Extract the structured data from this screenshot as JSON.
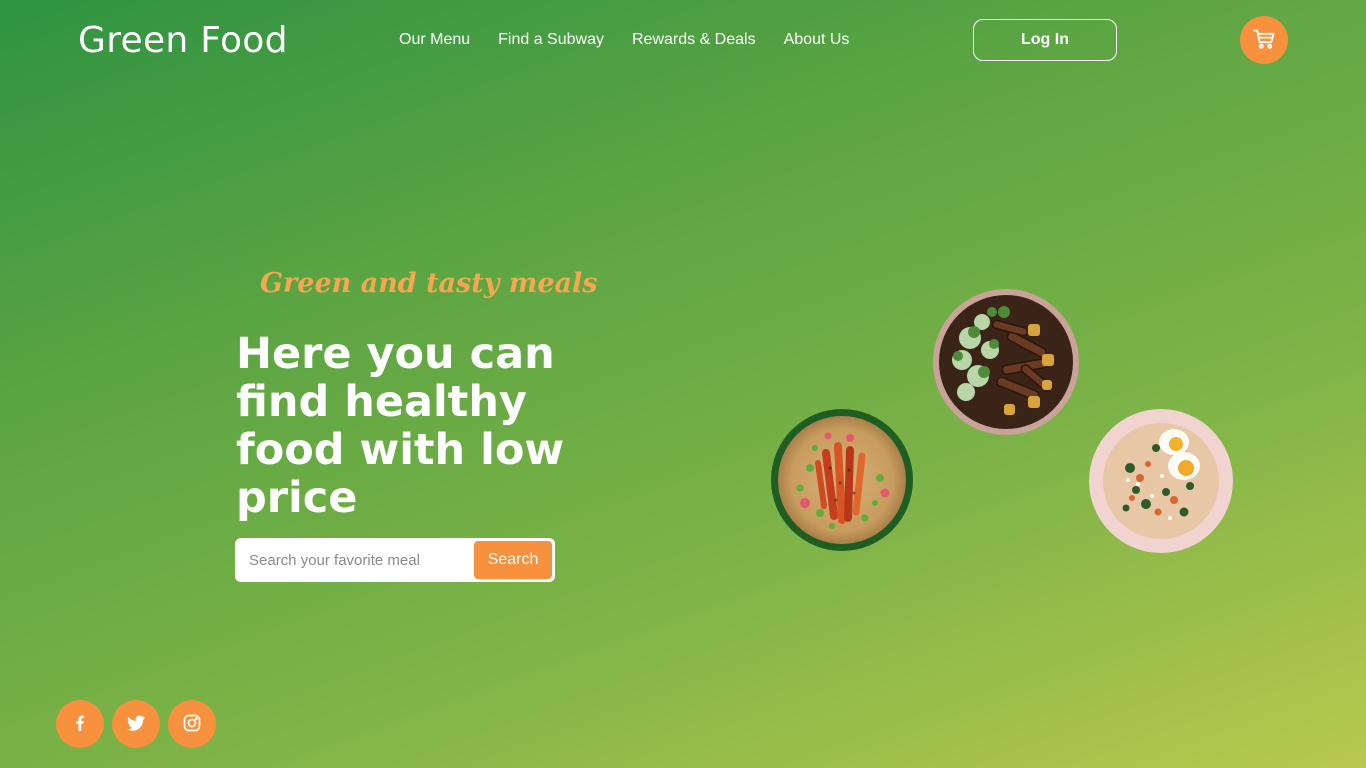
{
  "brand": {
    "logo_text": "Green Food"
  },
  "nav": {
    "items": [
      {
        "label": "Our Menu"
      },
      {
        "label": "Find a Subway"
      },
      {
        "label": "Rewards & Deals"
      },
      {
        "label": "About Us"
      }
    ],
    "login_label": "Log In",
    "cart_icon": "cart-icon"
  },
  "hero": {
    "tagline": "Green and tasty meals",
    "headline": "Here you can find healthy food with low price",
    "search": {
      "placeholder": "Search your favorite meal",
      "value": "",
      "button_label": "Search"
    }
  },
  "images": [
    {
      "name": "salmon-rice-bowl",
      "depicts": "bowl of rice with roasted carrots and vegetables"
    },
    {
      "name": "beef-broccoli-bowl",
      "depicts": "bowl of beef strips with broccoli and potatoes"
    },
    {
      "name": "egg-salad-bowl",
      "depicts": "bowl of salad with boiled eggs and greens"
    }
  ],
  "social": [
    {
      "icon": "facebook-icon"
    },
    {
      "icon": "twitter-icon"
    },
    {
      "icon": "instagram-icon"
    }
  ],
  "colors": {
    "accent": "#f7913d",
    "tagline": "#f6a74f",
    "bg_start": "#2f9341",
    "bg_end": "#b8c94d"
  }
}
